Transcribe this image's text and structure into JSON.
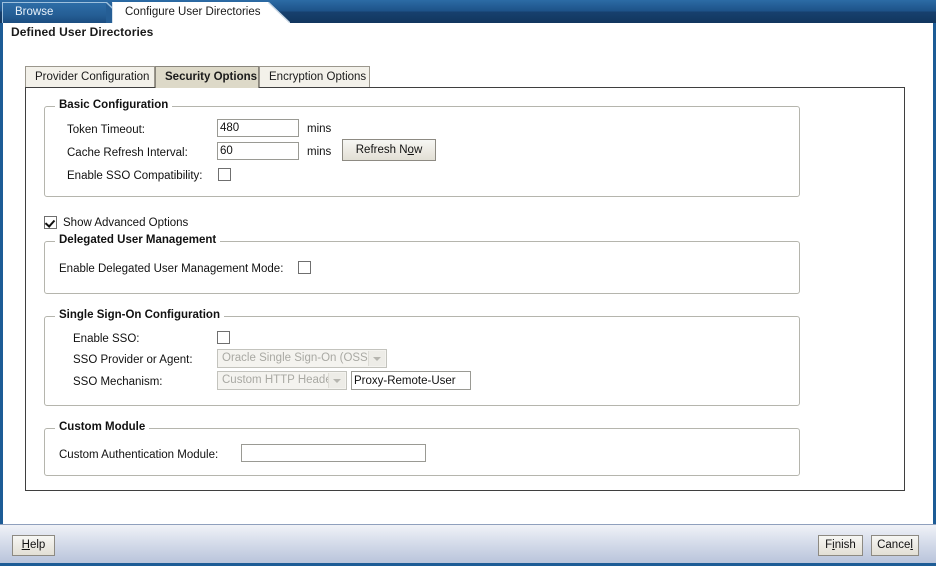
{
  "window": {
    "tabs": [
      {
        "label": "Browse",
        "active": false
      },
      {
        "label": "Configure User Directories",
        "active": true
      }
    ]
  },
  "page": {
    "heading": "Defined User Directories"
  },
  "inner_tabs": [
    {
      "label": "Provider Configuration",
      "active": false
    },
    {
      "label": "Security Options",
      "active": true
    },
    {
      "label": "Encryption Options",
      "active": false
    }
  ],
  "basic_configuration": {
    "legend": "Basic Configuration",
    "token_timeout": {
      "label": "Token Timeout:",
      "value": "480",
      "unit": "mins"
    },
    "cache_refresh_interval": {
      "label": "Cache Refresh Interval:",
      "value": "60",
      "unit": "mins"
    },
    "refresh_now_button": {
      "pre": "Refresh N",
      "mnemonic": "o",
      "post": "w"
    },
    "enable_sso_compatibility": {
      "label": "Enable SSO Compatibility:",
      "checked": false
    }
  },
  "show_advanced_options": {
    "label": "Show Advanced Options",
    "checked": true
  },
  "delegated_user_management": {
    "legend": "Delegated User Management",
    "enable_mode": {
      "label": "Enable Delegated User Management Mode:",
      "checked": false
    }
  },
  "single_sign_on": {
    "legend": "Single Sign-On Configuration",
    "enable_sso": {
      "label": "Enable SSO:",
      "checked": false
    },
    "provider_or_agent": {
      "label": "SSO Provider or Agent:",
      "value": "Oracle Single Sign-On (OSSO)",
      "disabled": true
    },
    "mechanism": {
      "label": "SSO Mechanism:",
      "value": "Custom HTTP Header",
      "disabled": true
    },
    "mechanism_header": {
      "value": "Proxy-Remote-User",
      "placeholder": ""
    }
  },
  "custom_module": {
    "legend": "Custom Module",
    "auth_module": {
      "label": "Custom Authentication Module:",
      "value": "",
      "placeholder": ""
    }
  },
  "footer": {
    "help": {
      "mnemonic": "H",
      "post": "elp"
    },
    "finish": {
      "pre": "F",
      "mnemonic": "i",
      "post": "nish"
    },
    "cancel": {
      "pre": "Cance",
      "mnemonic": "l",
      "post": ""
    }
  },
  "colors": {
    "titlebar_blue": "#1d5288",
    "window_border": "#1d5c96",
    "active_inner_tab": "#ddd9c8",
    "inactive_inner_tab": "#f3f1ea",
    "footer_gradient_top": "#f0f2f7",
    "footer_gradient_bottom": "#b9c4db"
  }
}
